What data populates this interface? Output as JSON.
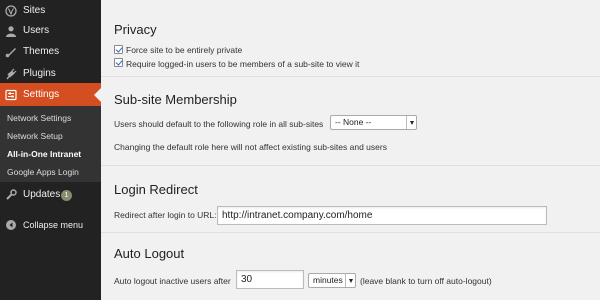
{
  "colors": {
    "sidebar_bg": "#222222",
    "submenu_bg": "#333333",
    "active_menu": "#d54e21",
    "content_bg": "#f1f1f1",
    "checkbox_check": "#2266cc"
  },
  "sidebar": {
    "items": [
      {
        "label": "Sites",
        "icon": "sites-icon"
      },
      {
        "label": "Users",
        "icon": "users-icon"
      },
      {
        "label": "Themes",
        "icon": "themes-icon"
      },
      {
        "label": "Plugins",
        "icon": "plugins-icon"
      },
      {
        "label": "Settings",
        "icon": "settings-icon",
        "active": true
      }
    ],
    "submenu": [
      {
        "label": "Network Settings"
      },
      {
        "label": "Network Setup"
      },
      {
        "label": "All-in-One Intranet",
        "current": true
      },
      {
        "label": "Google Apps Login"
      }
    ],
    "updates": {
      "label": "Updates",
      "badge": "1"
    },
    "collapse": {
      "label": "Collapse menu"
    }
  },
  "privacy": {
    "title": "Privacy",
    "options": [
      {
        "label": "Force site to be entirely private",
        "checked": true
      },
      {
        "label": "Require logged-in users to be members of a sub-site to view it",
        "checked": true
      }
    ]
  },
  "membership": {
    "title": "Sub-site Membership",
    "default_role_label": "Users should default to the following role in all sub-sites",
    "default_role_value": "-- None --",
    "note": "Changing the default role here will not affect existing sub-sites and users"
  },
  "login_redirect": {
    "title": "Login Redirect",
    "label": "Redirect after login to URL:",
    "value": "http://intranet.company.com/home"
  },
  "auto_logout": {
    "title": "Auto Logout",
    "label": "Auto logout inactive users after",
    "value": "30",
    "unit": "minutes",
    "hint": "(leave blank to turn off auto-logout)"
  }
}
